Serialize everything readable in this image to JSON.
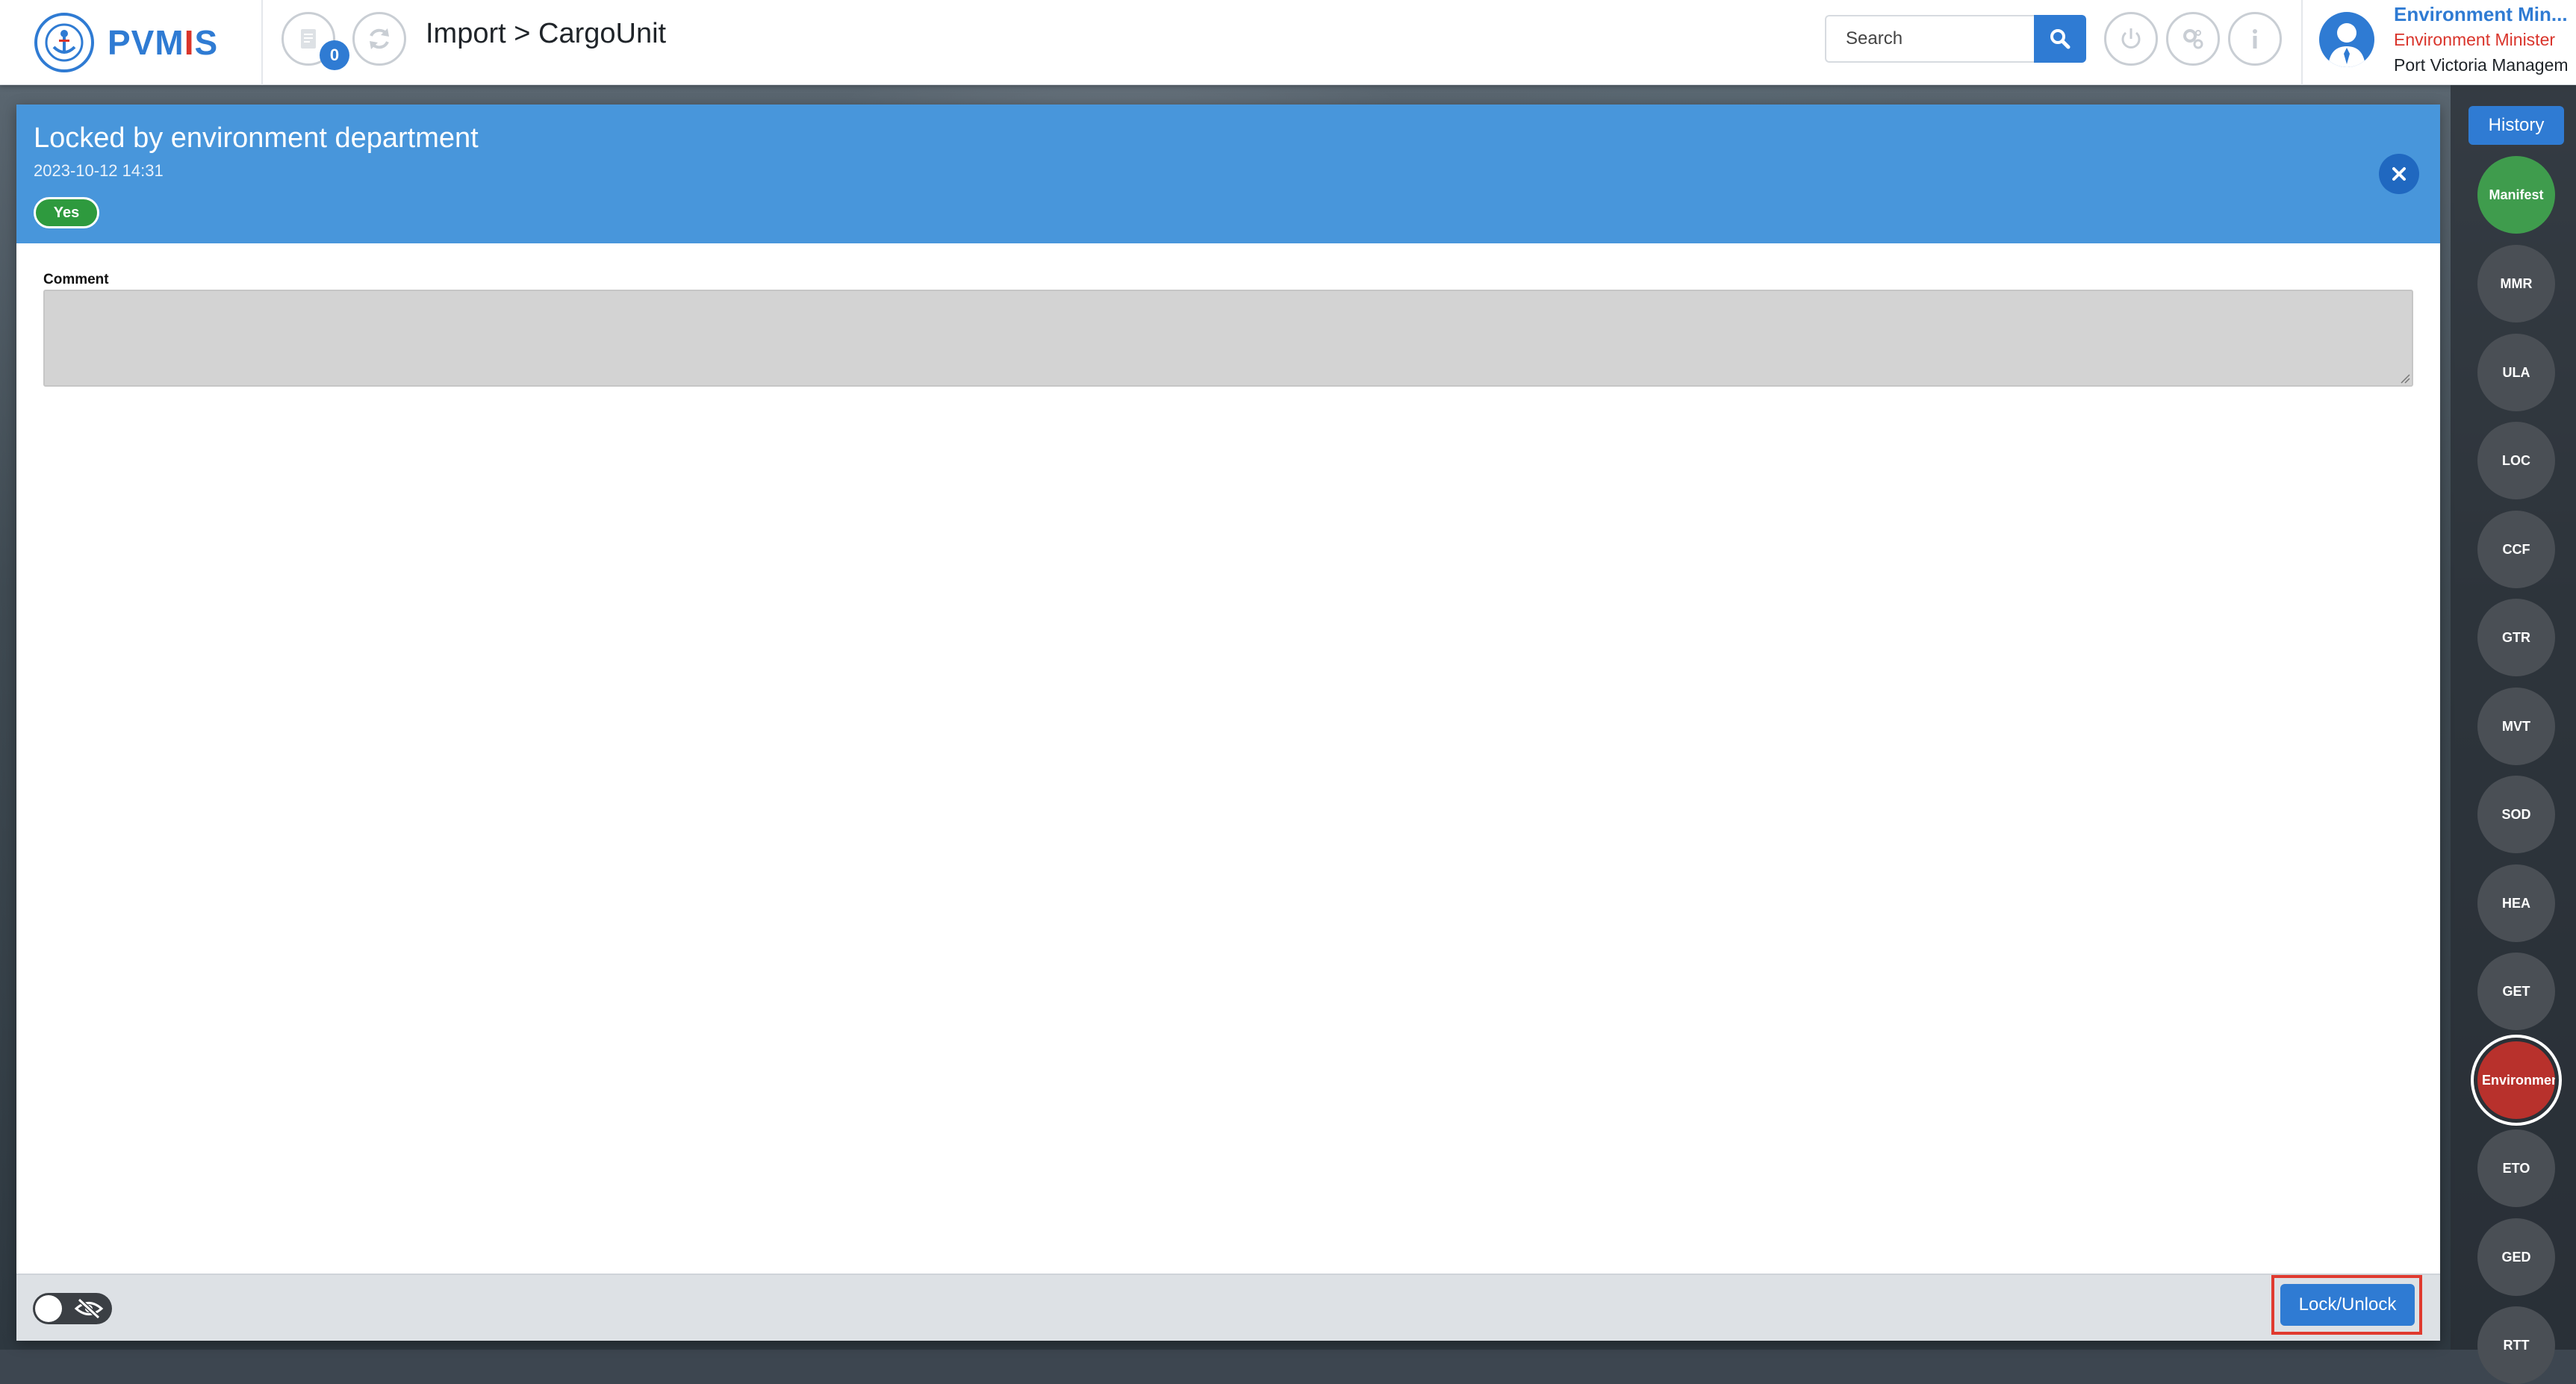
{
  "header": {
    "logo_text_pre": "PVM",
    "logo_text_i": "I",
    "logo_text_post": "S",
    "notification_count": "0",
    "breadcrumb": "Import > CargoUnit",
    "search_placeholder": "Search",
    "user": {
      "name": "Environment Min...",
      "role": "Environment Minister",
      "organization": "Port Victoria Managem"
    }
  },
  "panel": {
    "title": "Locked by environment department",
    "date": "2023-10-12 14:31",
    "status_pill": "Yes",
    "comment_label": "Comment",
    "comment_value": "",
    "footer": {
      "lock_button_label": "Lock/Unlock"
    }
  },
  "sidebar": {
    "history_label": "History",
    "items": [
      {
        "label": "Manifest",
        "state": "complete"
      },
      {
        "label": "MMR",
        "state": "default"
      },
      {
        "label": "ULA",
        "state": "default"
      },
      {
        "label": "LOC",
        "state": "default"
      },
      {
        "label": "CCF",
        "state": "default"
      },
      {
        "label": "GTR",
        "state": "default"
      },
      {
        "label": "MVT",
        "state": "default"
      },
      {
        "label": "SOD",
        "state": "default"
      },
      {
        "label": "HEA",
        "state": "default"
      },
      {
        "label": "GET",
        "state": "default"
      },
      {
        "label": "Environment",
        "state": "active-locked"
      },
      {
        "label": "ETO",
        "state": "default"
      },
      {
        "label": "GED",
        "state": "default"
      },
      {
        "label": "RTT",
        "state": "default"
      }
    ]
  },
  "colors": {
    "brand_blue": "#2f7bd3",
    "panel_header": "#4896db",
    "success_green": "#3f9c4d",
    "locked_red": "#b8312c",
    "highlight_red": "#e03a2f"
  }
}
